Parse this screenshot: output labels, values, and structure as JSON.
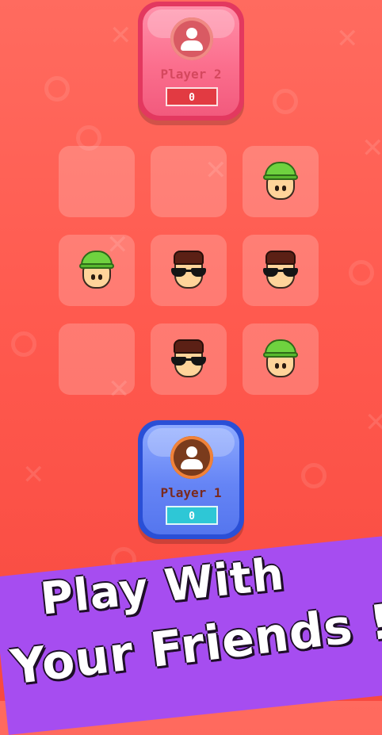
{
  "players": {
    "player2": {
      "name": "Player 2",
      "score": "0",
      "avatar_icon": "user-icon",
      "color": "#f25a7d"
    },
    "player1": {
      "name": "Player 1",
      "score": "0",
      "avatar_icon": "user-icon",
      "color": "#5576ee"
    }
  },
  "board": {
    "rows": [
      [
        "empty",
        "empty",
        "green-cap"
      ],
      [
        "green-cap",
        "sunglasses",
        "sunglasses"
      ],
      [
        "empty",
        "sunglasses",
        "green-cap"
      ]
    ]
  },
  "promo": {
    "line1": "Play With",
    "line2": "Your Friends !"
  },
  "colors": {
    "background": "#ff5a4f",
    "banner": "#a64df0"
  }
}
